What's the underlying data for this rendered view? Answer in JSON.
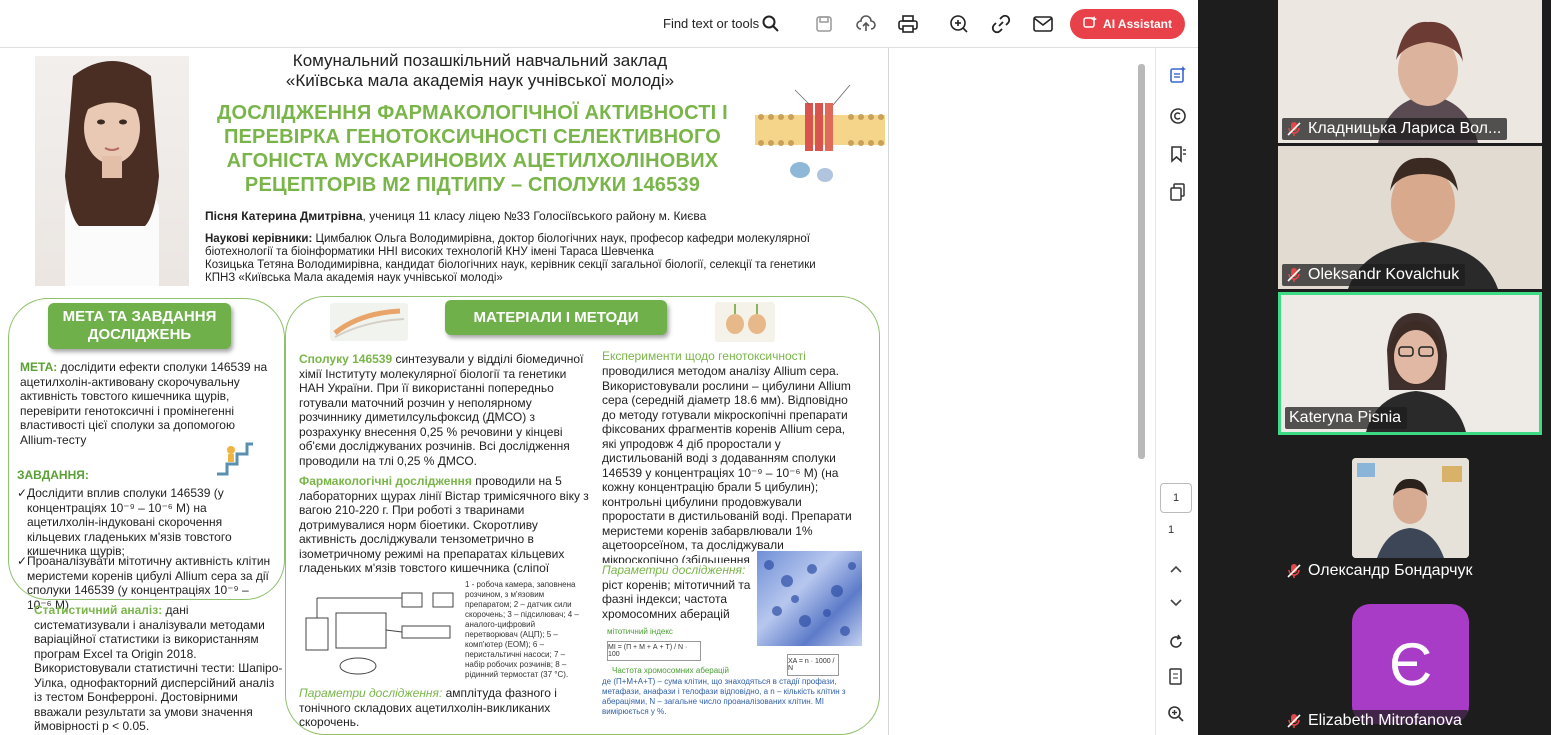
{
  "toolbar": {
    "find_label": "Find text or tools",
    "ai_label": "AI Assistant"
  },
  "page_nav": {
    "current_page": "1",
    "total_pages": "1"
  },
  "poster": {
    "header1": "Комунальний позашкільний навчальний заклад",
    "header2": "«Київська мала академія наук учнівської молоді»",
    "title": "ДОСЛІДЖЕННЯ ФАРМАКОЛОГІЧНОЇ АКТИВНОСТІ І ПЕРЕВІРКА ГЕНОТОКСИЧНОСТІ  СЕЛЕКТИВНОГО АГОНІСТА МУСКАРИНОВИХ АЦЕТИЛХОЛІНОВИХ РЕЦЕПТОРІВ М2 ПІДТИПУ – СПОЛУКИ 146539",
    "author_name": "Пісня Катерина Дмитрівна",
    "author_rest": ", учениця 11 класу ліцею №33 Голосіївського району м. Києва",
    "supervisors_label": "Наукові керівники:",
    "supervisors_line1": " Цимбалюк Ольга Володимирівна, доктор біологічних наук, професор кафедри молекулярної",
    "supervisors_line2": "біотехнології та біоінформатики ННІ високих технологій КНУ імені Тараса Шевченка",
    "supervisors_line3": "Козицька Тетяна Володимирівна, кандидат біологічних наук, керівник секції загальної біології, селекції та генетики",
    "supervisors_line4": "КПНЗ «Київська Мала академія наук учнівської молоді»",
    "goal_pill": "МЕТА ТА ЗАВДАННЯ ДОСЛІДЖЕНЬ",
    "methods_pill": "МАТЕРІАЛИ І МЕТОДИ",
    "goal_label": "МЕТА:",
    "goal_text": " дослідити ефекти сполуки 146539 на ацетилхолін-активовану скорочувальну активність товстого кишечника щурів, перевірити генотоксичні і промінегенні властивості цієї сполуки за допомогою Allium-тесту",
    "tasks_label": "ЗАВДАННЯ:",
    "task1": "Дослідити вплив сполуки 146539 (у концентраціях 10⁻⁹ – 10⁻⁶ М) на ацетилхолін-індуковані скорочення кільцевих гладеньких м'язів товстого кишечника щурів;",
    "task2": "Проаналізувати мітотичну активність клітин меристеми коренів цибулі Allium сера за дії сполуки 146539 (у концентраціях 10⁻⁹ – 10⁻⁶ М)",
    "stat_label": "Статистичний аналіз:",
    "stat_text": " дані систематизували і аналізували методами варіаційної статистики із використанням програм Excel та Origin 2018. Використовували статистичні тести: Шапіро-Уілка, однофакторний дисперсійний аналіз із тестом Бонферроні. Достовірними вважали результати за умови значення ймовірності р < 0.05.",
    "compound_label": "Сполуку 146539",
    "compound_text": " синтезували у відділі біомедичної хімії Інституту молекулярної біології та генетики НАН України. При її використанні попередньо готували маточний розчин у неполярному розчиннику диметилсульфоксид (ДМСО) з розрахунку внесення 0,25 % речовини у кінцеві об'єми  досліджуваних розчинів. Всі дослідження проводили на тлі 0,25 % ДМСО.",
    "pharm_label": "Фармакологічні дослідження",
    "pharm_text": " проводили на 5 лабораторних щурах лінії Вістар тримісячного віку з вагою 210-220 г. При роботі з тваринами дотримувалися норм біоетики. Скоротливу активність досліджували тензометрично в ізометричному режимі на препаратах кільцевих гладеньких м'язів товстого кишечника (сліпої",
    "setup_legend": "1 - робоча камера, заповнена розчином, з м'язовим препаратом; 2 – датчик сили скорочень; 3 – підсилювач; 4 – аналого-цифровий перетворювач (АЦП); 5 – комп'ютер (ЕОМ); 6 – перистальтичні насоси; 7 – набір робочих розчинів; 8 – рідинний термостат (37 °С).",
    "params_label": "Параметри дослідження:",
    "params_text": " амплітуда фазного і тонічного складових ацетилхолін-викликаних скорочень.",
    "geno_label": "Експерименти щодо генотоксичності",
    "geno_text": "проводилися методом аналізу Allium сера. Використовували рослини – цибулини Allium сера (середній діаметр 18.6 мм). Відповідно до методу готували мікроскопічні препарати фіксованих фрагментів коренів Allium сера, які упродовж 4 діб проростали у дистильованій воді з додаванням сполуки 146539 у концентраціях 10⁻⁹ – 10⁻⁶ М) (на кожну концентрацію брали 5 цибулин); контрольні цибулини продовжували проростати в дистильованій воді. Препарати меристеми коренів забарвлювали 1% ацетоорсеїном, та досліджували мікроскопічно (збільшення",
    "geno_params_label": "Параметри дослідження:",
    "geno_params_text": "ріст коренів; мітотичний та фазні індекси; частота хромосомних аберацій",
    "mitotic_index_label": "мітотичний індекс",
    "formula_mi": "MI = (П + М + А + Т) / N · 100",
    "formula_xa": "XA = n · 1000 / N",
    "aberr_label": "Частота хромосомних аберацій",
    "aberr_note": "де (П+М+А+Т) – сума клітин, що знаходяться в стадії профази, метафази, анафази і телофази відповідно, а n – кількість клітин з абераціями, N – загальне число проаналізованих клітин. МІ вимірюється у %."
  },
  "participants": [
    {
      "name": "Кладницька Лариса Вол...",
      "muted": true,
      "active": false
    },
    {
      "name": "Oleksandr Kovalchuk",
      "muted": true,
      "active": false
    },
    {
      "name": "Kateryna Pisnia",
      "muted": false,
      "active": true
    },
    {
      "name": "Олександр Бондарчук",
      "muted": true,
      "active": false
    },
    {
      "name": "Elizabeth Mitrofanova",
      "muted": true,
      "active": false,
      "initial": "Є"
    }
  ],
  "colors": {
    "accent_green": "#7ab54a",
    "ai_button": "#e8414a",
    "active_speaker": "#3ddc84",
    "avatar_purple": "#a93cc7"
  }
}
